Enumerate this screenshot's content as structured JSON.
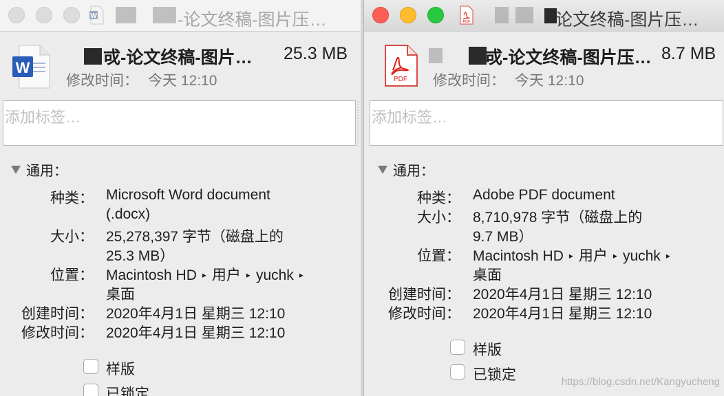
{
  "left": {
    "title_visible": "-论文终稿-图片压…",
    "file_name": "戓-论文终稿-图片…",
    "file_size": "25.3 MB",
    "modified_label": "修改时间：",
    "modified_value": "今天 12:10",
    "tags_placeholder": "添加标签…",
    "general_label": "通用：",
    "kind_label": "种类：",
    "kind_value_1": "Microsoft Word document",
    "kind_value_2": "(.docx)",
    "size_label": "大小：",
    "size_value_1": "25,278,397 字节（磁盘上的",
    "size_value_2": "25.3 MB）",
    "where_label": "位置：",
    "where_p1": "Macintosh HD",
    "where_p2": "用户",
    "where_p3": "yuchk",
    "where_p4": "桌面",
    "created_label": "创建时间：",
    "created_value": "2020年4月1日 星期三 12:10",
    "modified2_label": "修改时间：",
    "modified2_value": "2020年4月1日 星期三 12:10",
    "stationery_label": "样版",
    "locked_label": "已锁定",
    "icon": "word-doc-icon"
  },
  "right": {
    "title_visible": "论文终稿-图片压…",
    "file_name": "戓-论文终稿-图片压…",
    "file_size": "8.7 MB",
    "modified_label": "修改时间：",
    "modified_value": "今天 12:10",
    "tags_placeholder": "添加标签…",
    "general_label": "通用：",
    "kind_label": "种类：",
    "kind_value": "Adobe PDF document",
    "size_label": "大小：",
    "size_value_1": "8,710,978 字节（磁盘上的",
    "size_value_2": "9.7 MB）",
    "where_label": "位置：",
    "where_p1": "Macintosh HD",
    "where_p2": "用户",
    "where_p3": "yuchk",
    "where_p4": "桌面",
    "created_label": "创建时间：",
    "created_value": "2020年4月1日 星期三 12:10",
    "modified2_label": "修改时间：",
    "modified2_value": "2020年4月1日 星期三 12:10",
    "stationery_label": "样版",
    "locked_label": "已锁定",
    "icon": "pdf-icon",
    "pdf_badge": "PDF"
  },
  "watermark": "https://blog.csdn.net/Kangyucheng",
  "colors": {
    "close": "#fd5f57",
    "minimize": "#febc2e",
    "zoom": "#28c840",
    "pdf_red": "#e2231a",
    "word_blue": "#2b5cb8"
  }
}
